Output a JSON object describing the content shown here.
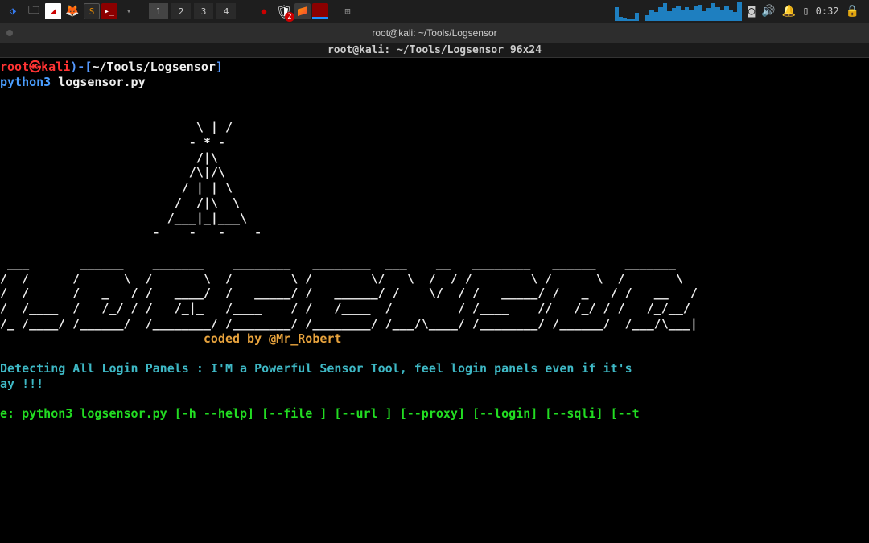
{
  "taskbar": {
    "workspaces": [
      "1",
      "2",
      "3",
      "4"
    ],
    "active_workspace": 0,
    "badge_count": "2",
    "time": "0:32"
  },
  "window": {
    "title": "root@kali: ~/Tools/Logsensor",
    "dimensions": "root@kali: ~/Tools/Logsensor 96x24"
  },
  "terminal": {
    "prompt": {
      "user": "root",
      "host": "kali",
      "sep1": ")-[",
      "path": "~/Tools/Logsensor",
      "sep2": "]"
    },
    "command": {
      "prog": "python3",
      "arg": "logsensor.py"
    },
    "ascii_tree": "                           \\ | /\n                          - * -\n                           /|\\ \n                          /\\|/\\\n                         / | | \\\n                        /  /|\\  \\\n                       /___|_|___\\\n                     -    -   -    -",
    "ascii_logo": " ___       ______    _______    ________   ________  ___    __   ________   ______    _______\n/  /      /      \\  /       \\  /        \\ /        \\/   \\  /  / /        \\ /      \\  /       \\\n/  /      /   _   / /   ____/  /   _____/ /   ______/ /    \\/  / /   _____/ /   _   / /   __   /\n/  /____  /   /_/ / /   /_|_   /____    / /   /____  /         / /____    //   /_/ / /   /_/__/\n/_ /____/ /______/  /________/ /________/ /________/ /___/\\____/ /________/ /______/  /___/\\___|",
    "coded_by": "coded by @Mr_Robert",
    "detecting": "Detecting All Login Panels : I'M a Powerful Sensor Tool, feel login panels even if it's ",
    "away": "ay !!!",
    "usage": "e: python3 logsensor.py [-h --help] [--file ] [--url ] [--proxy] [--login] [--sqli] [--t"
  }
}
